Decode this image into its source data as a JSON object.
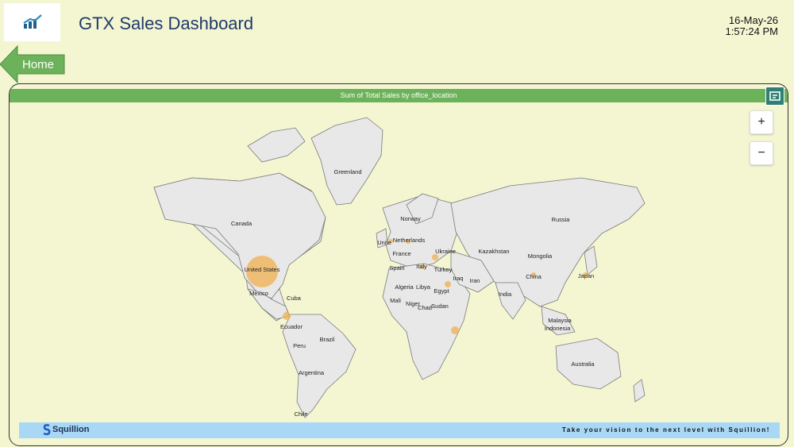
{
  "header": {
    "title": "GTX Sales Dashboard",
    "date": "16-May-26",
    "time": "1:57:24 PM"
  },
  "nav": {
    "home_label": "Home"
  },
  "map": {
    "title": "Sum of Total Sales by office_location",
    "zoom_in": "+",
    "zoom_out": "−",
    "bubble_color": "#f0b050",
    "labels": {
      "greenland": "Greenland",
      "canada": "Canada",
      "united_states": "United States",
      "mexico": "Mexico",
      "cuba": "Cuba",
      "ecuador": "Ecuador",
      "peru": "Peru",
      "brazil": "Brazil",
      "argentina": "Argentina",
      "chile": "Chile",
      "norway": "Norway",
      "united_kingdom": "Unite",
      "netherlands": "Netherlands",
      "france": "France",
      "spain": "Spain",
      "italy": "Italy",
      "ukraine": "Ukraine",
      "turkey": "Turkey",
      "iraq": "Iraq",
      "iran": "Iran",
      "algeria": "Algeria",
      "libya": "Libya",
      "egypt": "Egypt",
      "mali": "Mali",
      "niger": "Niger",
      "chad": "Chad",
      "sudan": "Sudan",
      "russia": "Russia",
      "kazakhstan": "Kazakhstan",
      "mongolia": "Mongolia",
      "china": "China",
      "japan": "Japan",
      "india": "India",
      "malaysia": "Malaysia",
      "indonesia": "Indonesia",
      "australia": "Australia"
    }
  },
  "footer": {
    "brand": "Squillion",
    "tagline": "Take your vision to the next level with Squillion!"
  }
}
